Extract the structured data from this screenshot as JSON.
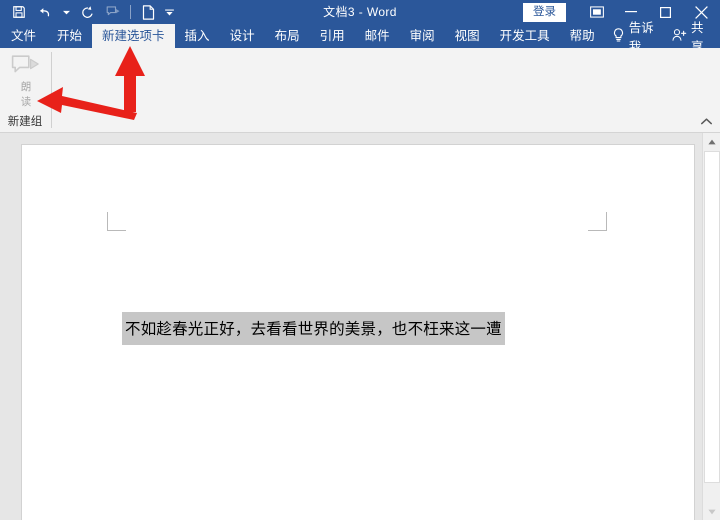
{
  "titlebar": {
    "document_title": "文档3  -  Word",
    "signin_label": "登录",
    "quick_access": [
      {
        "name": "save-icon",
        "label": "保存",
        "disabled": false
      },
      {
        "name": "undo-icon",
        "label": "撤消",
        "disabled": false
      },
      {
        "name": "redo-icon",
        "label": "重复",
        "disabled": false
      },
      {
        "name": "read-aloud-icon",
        "label": "朗读",
        "disabled": true
      },
      {
        "name": "new-document-icon",
        "label": "新建",
        "disabled": false
      }
    ],
    "window_controls": {
      "ribbon_display_options": "功能区显示选项",
      "minimize": "最小化",
      "maximize": "最大化",
      "close": "关闭"
    },
    "colors": {
      "titlebar_bg": "#2b579a",
      "titlebar_text": "#ffffff"
    }
  },
  "tabs": {
    "items": [
      {
        "label": "文件",
        "active": false
      },
      {
        "label": "开始",
        "active": false
      },
      {
        "label": "新建选项卡",
        "active": true
      },
      {
        "label": "插入",
        "active": false
      },
      {
        "label": "设计",
        "active": false
      },
      {
        "label": "布局",
        "active": false
      },
      {
        "label": "引用",
        "active": false
      },
      {
        "label": "邮件",
        "active": false
      },
      {
        "label": "审阅",
        "active": false
      },
      {
        "label": "视图",
        "active": false
      },
      {
        "label": "开发工具",
        "active": false
      },
      {
        "label": "帮助",
        "active": false
      }
    ],
    "tell_me": "告诉我",
    "share": "共享",
    "active_tab_bg": "#f3f3f3",
    "active_tab_text": "#2b579a"
  },
  "ribbon": {
    "group_title": "新建组",
    "button": {
      "label_line1": "朗",
      "label_line2": "读",
      "icon": "read-aloud-icon",
      "disabled": true
    },
    "collapse_tooltip": "折叠功能区",
    "bg": "#f3f3f3"
  },
  "document": {
    "paragraph_text": "不如趁春光正好，去看看世界的美景，也不枉来这一遭",
    "selection_highlight_color": "#c6c6c6",
    "page_bg": "#ffffff",
    "workspace_bg": "#e6e6e6"
  },
  "scrollbar": {
    "up_arrow": "▲",
    "down_arrow": "▼"
  },
  "annotations": {
    "arrow_color": "#e8211a",
    "arrow_up_target": "新建选项卡",
    "arrow_left_target": "朗读"
  }
}
